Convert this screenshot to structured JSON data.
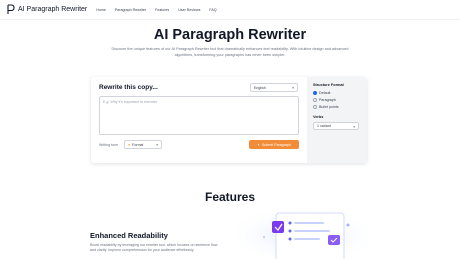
{
  "header": {
    "logo_text": "AI Paragraph Rewriter",
    "nav": [
      "Home",
      "Paragraph Rewriter",
      "Features",
      "User Reviews",
      "FAQ"
    ]
  },
  "hero": {
    "title": "AI Paragraph Rewriter",
    "description": "Discover the unique features of our AI Paragraph Rewriter tool that dramatically enhances text readability. With intuitive design and advanced algorithms, transforming your paragraphs has never been simpler."
  },
  "form": {
    "title": "Rewrite this copy...",
    "language": "English",
    "textarea_placeholder": "E.g. Why it's important to exercise",
    "tone_label": "Writing tone",
    "tone_value": "Formal",
    "submit_label": "Submit Paragraph"
  },
  "sidebar": {
    "structure_heading": "Structure Format",
    "options": [
      "Default",
      "Paragraph",
      "Bullet points"
    ],
    "selected": "Default",
    "verbs_heading": "Verbs",
    "verbs_value": "1 variant"
  },
  "features": {
    "title": "Features",
    "item_title": "Enhanced Readability",
    "item_desc": "Boost readability by leveraging our rewriter tool, which focuses on sentence flow and clarity. Improve comprehension for your audience effortlessly."
  },
  "colors": {
    "accent": "#f28c38",
    "radio_selected": "#2563eb",
    "sidebar_bg": "#f3f4f6"
  }
}
